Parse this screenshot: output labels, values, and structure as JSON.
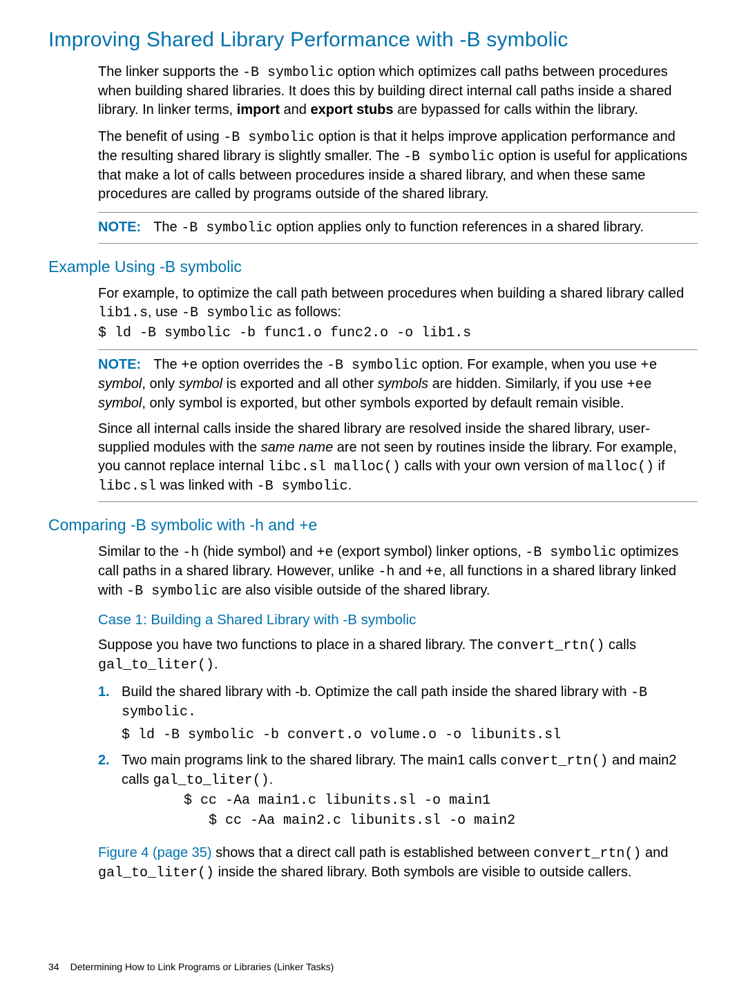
{
  "title": "Improving Shared Library Performance with -B symbolic",
  "intro": {
    "p1a": "The linker supports the ",
    "p1code": "-B symbolic",
    "p1b": " option which optimizes call paths between procedures when building shared libraries. It does this by building direct internal call paths inside a shared library. In linker terms, ",
    "p1bold1": "import",
    "p1mid": " and ",
    "p1bold2": "export stubs",
    "p1c": " are bypassed for calls within the library.",
    "p2a": "The benefit of using ",
    "p2code1": "-B symbolic",
    "p2b": " option is that it helps improve application performance and the resulting shared library is slightly smaller. The ",
    "p2code2": "-B symbolic",
    "p2c": " option is useful for applications that make a lot of calls between procedures inside a shared library, and when these same procedures are called by programs outside of the shared library."
  },
  "note1": {
    "label": "NOTE:",
    "a": "The ",
    "code": "-B symbolic",
    "b": " option applies only to function references in a shared library."
  },
  "example": {
    "heading": "Example Using -B symbolic",
    "p1a": "For example, to optimize the call path between procedures when building a shared library called ",
    "p1code1": "lib1.s",
    "p1mid": ", use ",
    "p1code2": "-B symbolic",
    "p1b": " as follows:",
    "cmd": "$ ld -B symbolic -b func1.o func2.o -o lib1.s"
  },
  "note2": {
    "label": "NOTE:",
    "p1a": "The ",
    "p1code1": "+e",
    "p1b": " option overrides the  ",
    "p1code2": "-B symbolic",
    "p1c": " option. For example, when you use ",
    "p1code3": "+e",
    "p1d": " ",
    "p1it1": "symbol",
    "p1e": ", only ",
    "p1it2": "symbol",
    "p1f": " is exported and all other ",
    "p1it3": "symbols",
    "p1g": " are hidden. Similarly, if you use ",
    "p1code4": "+ee",
    "p1h": " ",
    "p1it4": "symbol",
    "p1i": ", only symbol is exported, but other symbols exported by default remain visible.",
    "p2a": "Since all internal calls inside the shared library are resolved inside the shared library, user-supplied modules with the ",
    "p2it": "same name",
    "p2b": " are not seen by routines inside the library. For example, you cannot replace internal ",
    "p2code1": "libc.sl malloc()",
    "p2c": " calls with your own version of ",
    "p2code2": "malloc()",
    "p2d": " if ",
    "p2code3": "libc.sl",
    "p2e": " was linked with ",
    "p2code4": "-B symbolic",
    "p2f": "."
  },
  "compare": {
    "heading": "Comparing -B symbolic with -h and +e",
    "p1a": "Similar to the ",
    "p1code1": "-h",
    "p1b": " (hide symbol) and ",
    "p1code2": "+e",
    "p1c": " (export symbol) linker options, ",
    "p1code3": "-B symbolic",
    "p1d": " optimizes call paths in a shared library. However, unlike ",
    "p1code4": "-h",
    "p1e": " and ",
    "p1code5": "+e",
    "p1f": ", all functions in a shared library linked with ",
    "p1code6": "-B symbolic",
    "p1g": " are also visible outside of the shared library."
  },
  "case1": {
    "heading": "Case 1: Building a Shared Library with -B symbolic",
    "p1a": "Suppose you have two functions to place in a shared library. The ",
    "p1code1": "convert_rtn()",
    "p1b": " calls ",
    "p1code2": "gal_to_liter()",
    "p1c": ".",
    "steps": [
      {
        "num": "1.",
        "a": "Build the shared library with -b. Optimize the call path inside the shared library with ",
        "code1": "-B symbolic.",
        "cmd": "$ ld -B symbolic -b convert.o volume.o -o libunits.sl"
      },
      {
        "num": "2.",
        "a": "Two main programs link to the shared library. The main1 calls ",
        "code1": "convert_rtn()",
        "b": " and main2 calls ",
        "code2": "gal_to_liter()",
        "c": ".",
        "cmd1": "$ cc -Aa main1.c libunits.sl -o main1",
        "cmd2": "   $ cc -Aa main2.c libunits.sl -o main2"
      }
    ],
    "after_link": "Figure 4 (page 35)",
    "after_a": " shows that a direct call path is established between ",
    "after_code1": "convert_rtn()",
    "after_b": " and ",
    "after_code2": "gal_to_liter()",
    "after_c": " inside the shared library. Both symbols are visible to outside callers."
  },
  "footer": {
    "page": "34",
    "text": "Determining How to Link Programs or Libraries (Linker Tasks)"
  }
}
